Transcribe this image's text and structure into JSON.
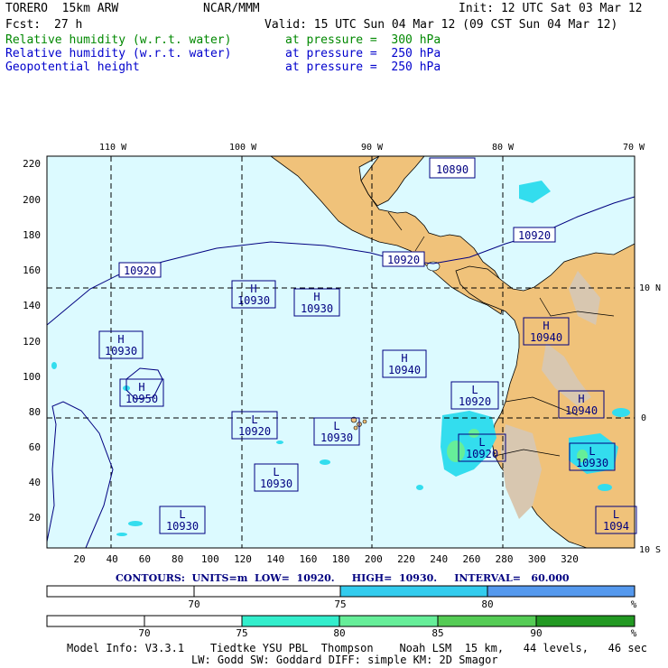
{
  "header": {
    "model": "TORERO  15km ARW",
    "org": "NCAR/MMM",
    "init": "Init: 12 UTC Sat 03 Mar 12",
    "fcst_label": "Fcst:",
    "fcst_value": "27 h",
    "valid": "Valid: 15 UTC Sun 04 Mar 12 (09 CST Sun 04 Mar 12)",
    "fields": [
      {
        "name": "Relative humidity (w.r.t. water)",
        "level": "at pressure =  300 hPa",
        "color": "#008800"
      },
      {
        "name": "Relative humidity (w.r.t. water)",
        "level": "at pressure =  250 hPa",
        "color": "#0000cc"
      },
      {
        "name": "Geopotential height",
        "level": "at pressure =  250 hPa",
        "color": "#0000cc"
      }
    ]
  },
  "map": {
    "lon_labels": [
      "110 W",
      "100 W",
      "90 W",
      "80 W",
      "70 W"
    ],
    "lat_labels": [
      "10 N",
      "0",
      "10 S"
    ],
    "y_ticks": [
      "220",
      "200",
      "180",
      "160",
      "140",
      "120",
      "100",
      "80",
      "60",
      "40",
      "20"
    ],
    "x_ticks": [
      "20",
      "40",
      "60",
      "80",
      "100",
      "120",
      "140",
      "160",
      "180",
      "200",
      "220",
      "240",
      "260",
      "280",
      "300",
      "320"
    ],
    "contour_labels": [
      "10890",
      "10920",
      "10920",
      "10920",
      "10930"
    ],
    "highs": [
      {
        "letter": "H",
        "value": "10930"
      },
      {
        "letter": "H",
        "value": "10930"
      },
      {
        "letter": "H",
        "value": "10930"
      },
      {
        "letter": "H",
        "value": "10950"
      },
      {
        "letter": "H",
        "value": "10940"
      },
      {
        "letter": "H",
        "value": "10940"
      },
      {
        "letter": "H",
        "value": "10940"
      }
    ],
    "lows": [
      {
        "letter": "L",
        "value": "10920"
      },
      {
        "letter": "L",
        "value": "10920"
      },
      {
        "letter": "L",
        "value": "10930"
      },
      {
        "letter": "L",
        "value": "10920"
      },
      {
        "letter": "L",
        "value": "10930"
      },
      {
        "letter": "L",
        "value": "10930"
      },
      {
        "letter": "L",
        "value": "10930"
      },
      {
        "letter": "L",
        "value": "1094"
      }
    ],
    "colors": {
      "ocean": "#dcfaff",
      "land": "#f0c27a",
      "contour": "#000080",
      "humid_cyan": "#33ddee"
    }
  },
  "contours_info": "CONTOURS:  UNITS=m  LOW=  10920.     HIGH=  10930.     INTERVAL=   60.000",
  "colorbar1": {
    "ticks": [
      "70",
      "75",
      "80"
    ],
    "unit": "%",
    "colors": [
      "#ffffff",
      "#ffffff",
      "#33ccee",
      "#5599ee"
    ]
  },
  "colorbar2": {
    "ticks": [
      "70",
      "75",
      "80",
      "85",
      "90"
    ],
    "unit": "%",
    "colors": [
      "#ffffff",
      "#ffffff",
      "#33eecc",
      "#66ee99",
      "#55cc55",
      "#229922"
    ]
  },
  "footer": {
    "line1": "Model Info: V3.3.1    Tiedtke YSU PBL  Thompson    Noah LSM  15 km,   44 levels,   46 sec",
    "line2": "LW: Godd SW: Goddard DIFF: simple KM: 2D Smagor"
  }
}
